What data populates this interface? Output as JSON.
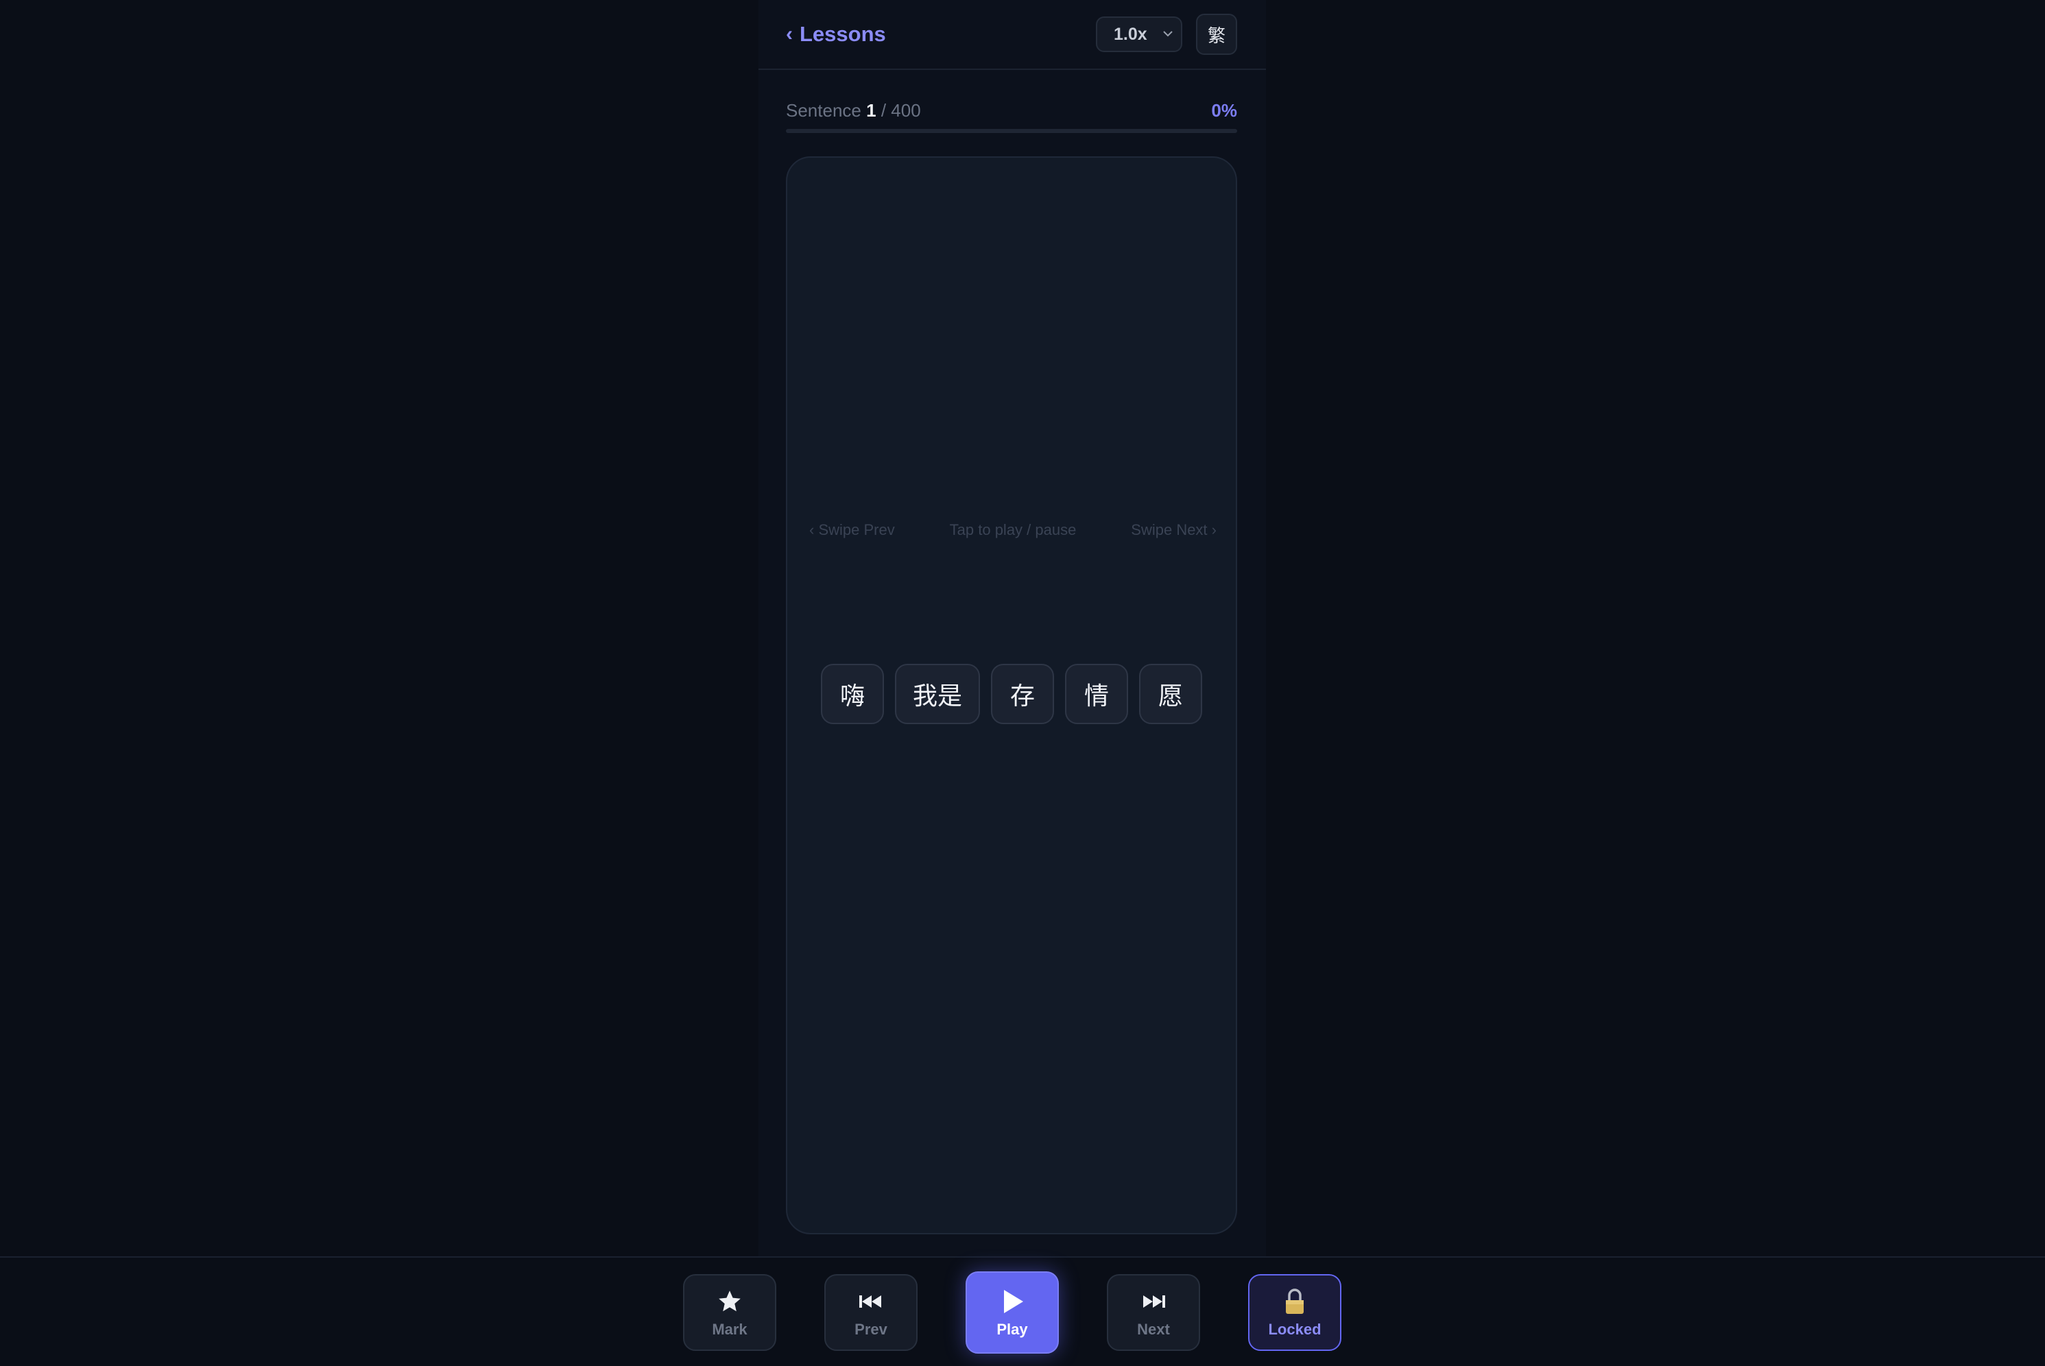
{
  "header": {
    "back_label": "Lessons",
    "speed_value": "1.0x",
    "speed_options": [
      "1.0x"
    ],
    "script_toggle_label": "繁"
  },
  "progress": {
    "label_prefix": "Sentence",
    "current": "1",
    "separator": "/",
    "total": "400",
    "percent_label": "0%",
    "fraction": 0.0
  },
  "card": {
    "hint_prev": "‹ Swipe Prev",
    "hint_tap": "Tap to play / pause",
    "hint_next": "Swipe Next ›",
    "words": [
      "嗨",
      "我是",
      "存",
      "情",
      "愿"
    ]
  },
  "controls": {
    "mark_label": "Mark",
    "prev_label": "Prev",
    "play_label": "Play",
    "next_label": "Next",
    "locked_label": "Locked"
  },
  "colors": {
    "accent": "#6366f1",
    "background": "#0a0e17",
    "card": "#121a27"
  },
  "icons": [
    "chevron-left-icon",
    "chevron-down-icon",
    "star-icon",
    "skip-back-icon",
    "play-icon",
    "skip-forward-icon",
    "lock-icon"
  ]
}
